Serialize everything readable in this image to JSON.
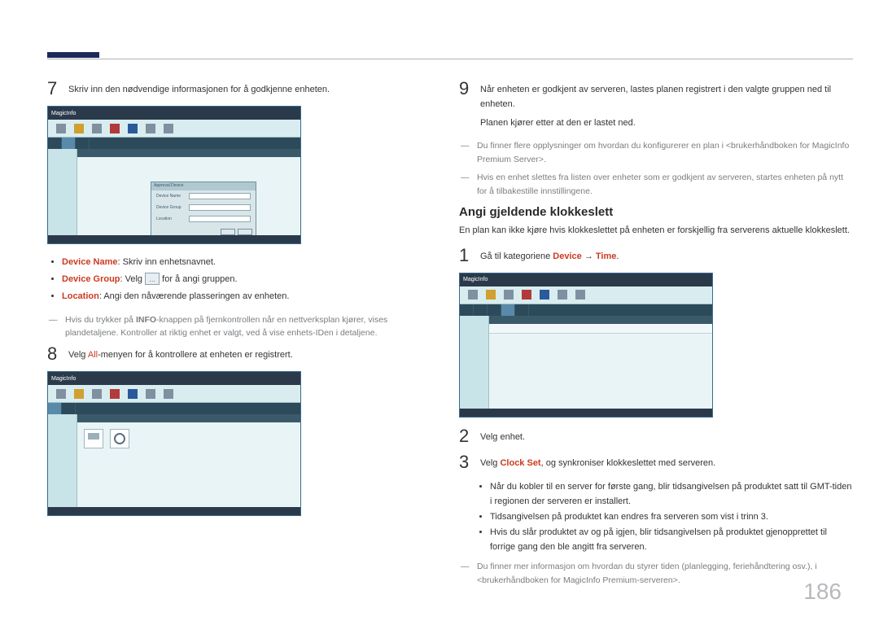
{
  "page_number": "186",
  "left": {
    "step7": {
      "num": "7",
      "text": "Skriv inn den nødvendige informasjonen for å godkjenne enheten."
    },
    "screenshot7": {
      "logo": "MagicInfo",
      "dialog_title": "Approval Device",
      "field_device_name": "Device Name",
      "field_device_group": "Device Group",
      "field_location": "Location"
    },
    "bullets7": [
      {
        "label": "Device Name",
        "text": ": Skriv inn enhetsnavnet."
      },
      {
        "label": "Device Group",
        "text": ": Velg ",
        "after_icon": " for å angi gruppen."
      },
      {
        "label": "Location",
        "text": ": Angi den nåværende plasseringen av enheten."
      }
    ],
    "note7": "Hvis du trykker på INFO-knappen på fjernkontrollen når en nettverksplan kjører, vises plandetaljene. Kontroller at riktig enhet er valgt, ved å vise enhets-IDen i detaljene.",
    "note7_bold": "INFO",
    "step8": {
      "num": "8",
      "text_pre": "Velg ",
      "text_hl": "All",
      "text_post": "-menyen for å kontrollere at enheten er registrert."
    },
    "screenshot8": {
      "logo": "MagicInfo"
    }
  },
  "right": {
    "step9": {
      "num": "9",
      "line1": "Når enheten er godkjent av serveren, lastes planen registrert i den valgte gruppen ned til enheten.",
      "line2": "Planen kjører etter at den er lastet ned."
    },
    "note9a": "Du finner flere opplysninger om hvordan du konfigurerer en plan i <brukerhåndboken for MagicInfo Premium Server>.",
    "note9b": "Hvis en enhet slettes fra listen over enheter som er godkjent av serveren, startes enheten på nytt for å tilbakestille innstillingene.",
    "section_title": "Angi gjeldende klokkeslett",
    "section_desc": "En plan kan ikke kjøre hvis klokkeslettet på enheten er forskjellig fra serverens aktuelle klokkeslett.",
    "step1": {
      "num": "1",
      "text_pre": "Gå til kategoriene ",
      "hl1": "Device",
      "mid": " → ",
      "hl2": "Time",
      "post": "."
    },
    "screenshot_time": {
      "logo": "MagicInfo"
    },
    "step2": {
      "num": "2",
      "text": "Velg enhet."
    },
    "step3": {
      "num": "3",
      "text_pre": "Velg ",
      "hl": "Clock Set",
      "text_post": ", og synkroniser klokkeslettet med serveren."
    },
    "sub_bullets": [
      "Når du kobler til en server for første gang, blir tidsangivelsen på produktet satt til GMT-tiden i regionen der serveren er installert.",
      "Tidsangivelsen på produktet kan endres fra serveren som vist i trinn 3.",
      "Hvis du slår produktet av og på igjen, blir tidsangivelsen på produktet gjenopprettet til forrige gang den ble angitt fra serveren."
    ],
    "final_note": "Du finner mer informasjon om hvordan du styrer tiden (planlegging, feriehåndtering osv.), i <brukerhåndboken for MagicInfo Premium-serveren>."
  }
}
